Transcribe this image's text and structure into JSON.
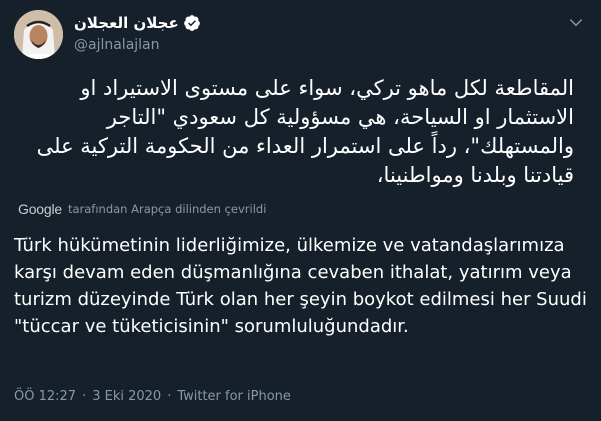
{
  "author": {
    "display_name": "عجلان العجلان",
    "handle": "@ajlnalajlan",
    "verified": true
  },
  "tweet": {
    "text_original": "المقاطعة لكل ماهو تركي، سواء على مستوى الاستيراد او الاستثمار او السياحة، هي مسؤولية كل سعودي \"التاجر والمستهلك\"، رداً على استمرار العداء من الحكومة التركية على قيادتنا وبلدنا ومواطنينا،",
    "translation_brand": "Google",
    "translation_note": "tarafından Arapça dilinden çevrildi",
    "text_translated": "Türk hükümetinin liderliğimize, ülkemize ve vatandaşlarımıza karşı devam eden düşmanlığına cevaben ithalat, yatırım veya turizm düzeyinde Türk olan her şeyin boykot edilmesi her Suudi \"tüccar ve tüketicisinin\" sorumluluğundadır."
  },
  "meta": {
    "time": "ÖÖ 12:27",
    "separator": "·",
    "date": "3 Eki 2020",
    "source": "Twitter for iPhone"
  },
  "icons": {
    "verified": "verified-badge-icon",
    "menu": "chevron-down-icon",
    "avatar": "user-avatar"
  },
  "colors": {
    "background": "#15202b",
    "text_primary": "#ffffff",
    "text_secondary": "#8899a6",
    "accent": "#1da1f2"
  }
}
